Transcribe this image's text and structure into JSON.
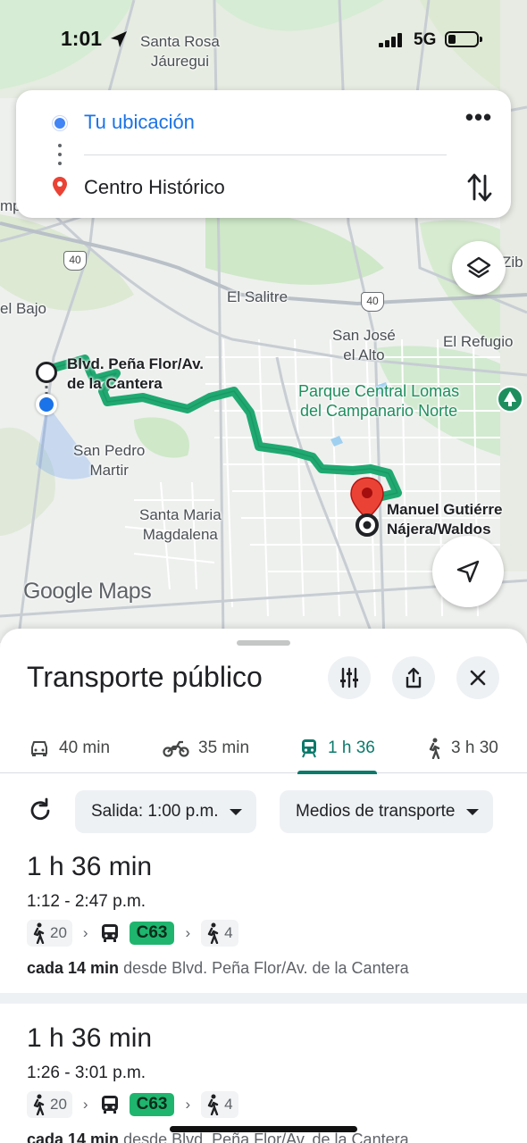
{
  "status_bar": {
    "time": "1:01",
    "network": "5G"
  },
  "search": {
    "origin": "Tu ubicación",
    "destination": "Centro Histórico",
    "more_icon": "more-horizontal-icon",
    "swap_icon": "swap-vertical-icon"
  },
  "map": {
    "labels": {
      "santa_rosa": "Santa Rosa\nJáuregui",
      "el_salitre": "El Salitre",
      "san_jose": "San José\nel Alto",
      "el_refugio": "El Refugio",
      "parque": "Parque Central Lomas\ndel Campanario Norte",
      "el_bajo": "el Bajo",
      "san_pedro": "San Pedro\nMartir",
      "santa_maria": "Santa Maria\nMagdalena",
      "zib": "Zib",
      "mpa": "mpa",
      "start_stop": "Blvd. Peña Flor/Av.\nde la Cantera",
      "end_stop": "Manuel Gutiérre\nNájera/Waldos"
    },
    "highway_shields": [
      "40",
      "40"
    ],
    "logo": "Google Maps",
    "route_color": "#1fa971"
  },
  "sheet": {
    "title": "Transporte público",
    "modes": [
      {
        "icon": "car-icon",
        "label": "40 min"
      },
      {
        "icon": "motorcycle-icon",
        "label": "35 min"
      },
      {
        "icon": "transit-icon",
        "label": "1 h 36",
        "active": true
      },
      {
        "icon": "walk-icon",
        "label": "3 h 30"
      }
    ],
    "departure_chip": "Salida: 1:00 p.m.",
    "transport_chip": "Medios de transporte",
    "routes": [
      {
        "duration": "1 h 36 min",
        "times": "1:12 - 2:47 p.m.",
        "walk_before": "20",
        "bus": "C63",
        "walk_after": "4",
        "freq_bold": "cada 14 min",
        "freq_rest": "desde Blvd. Peña Flor/Av. de la Cantera"
      },
      {
        "duration": "1 h 36 min",
        "times": "1:26 - 3:01 p.m.",
        "walk_before": "20",
        "bus": "C63",
        "walk_after": "4",
        "freq_bold": "cada 14 min",
        "freq_rest": "desde Blvd. Peña Flor/Av. de la Cantera"
      }
    ]
  },
  "colors": {
    "accent": "#0b7a6b",
    "link_blue": "#1a73e8",
    "bus_badge": "#1fb56e"
  }
}
